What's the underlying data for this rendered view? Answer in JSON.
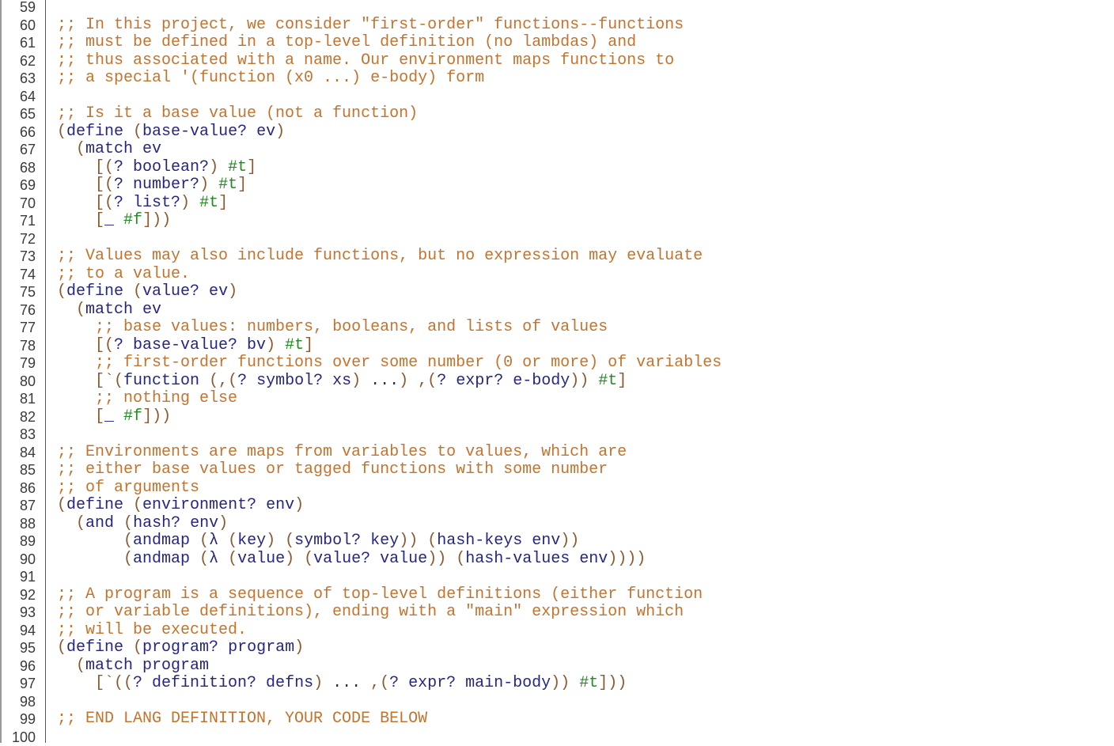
{
  "editor": {
    "colors": {
      "comment": "#c2742f",
      "paren": "#8a5a30",
      "identifier": "#262680",
      "boolean": "#228b22",
      "line_number": "#3a3a3a"
    },
    "lines": [
      {
        "n": "59",
        "tokens": []
      },
      {
        "n": "60",
        "tokens": [
          {
            "t": "c",
            "v": ";; In this project, we consider \"first-order\" functions--functions"
          }
        ]
      },
      {
        "n": "61",
        "tokens": [
          {
            "t": "c",
            "v": ";; must be defined in a top-level definition (no lambdas) and"
          }
        ]
      },
      {
        "n": "62",
        "tokens": [
          {
            "t": "c",
            "v": ";; thus associated with a name. Our environment maps functions to"
          }
        ]
      },
      {
        "n": "63",
        "tokens": [
          {
            "t": "c",
            "v": ";; a special '(function (x0 ...) e-body) form"
          }
        ]
      },
      {
        "n": "64",
        "tokens": []
      },
      {
        "n": "65",
        "tokens": [
          {
            "t": "c",
            "v": ";; Is it a base value (not a function)"
          }
        ]
      },
      {
        "n": "66",
        "tokens": [
          {
            "t": "p",
            "v": "("
          },
          {
            "t": "i",
            "v": "define "
          },
          {
            "t": "p",
            "v": "("
          },
          {
            "t": "i",
            "v": "base-value? ev"
          },
          {
            "t": "p",
            "v": ")"
          }
        ]
      },
      {
        "n": "67",
        "tokens": [
          {
            "t": "i",
            "v": "  "
          },
          {
            "t": "p",
            "v": "("
          },
          {
            "t": "i",
            "v": "match ev"
          }
        ]
      },
      {
        "n": "68",
        "tokens": [
          {
            "t": "i",
            "v": "    "
          },
          {
            "t": "p",
            "v": "[("
          },
          {
            "t": "i",
            "v": "? boolean?"
          },
          {
            "t": "p",
            "v": ")"
          },
          {
            "t": "i",
            "v": " "
          },
          {
            "t": "b",
            "v": "#t"
          },
          {
            "t": "p",
            "v": "]"
          }
        ]
      },
      {
        "n": "69",
        "tokens": [
          {
            "t": "i",
            "v": "    "
          },
          {
            "t": "p",
            "v": "[("
          },
          {
            "t": "i",
            "v": "? number?"
          },
          {
            "t": "p",
            "v": ")"
          },
          {
            "t": "i",
            "v": " "
          },
          {
            "t": "b",
            "v": "#t"
          },
          {
            "t": "p",
            "v": "]"
          }
        ]
      },
      {
        "n": "70",
        "tokens": [
          {
            "t": "i",
            "v": "    "
          },
          {
            "t": "p",
            "v": "[("
          },
          {
            "t": "i",
            "v": "? list?"
          },
          {
            "t": "p",
            "v": ")"
          },
          {
            "t": "i",
            "v": " "
          },
          {
            "t": "b",
            "v": "#t"
          },
          {
            "t": "p",
            "v": "]"
          }
        ]
      },
      {
        "n": "71",
        "tokens": [
          {
            "t": "i",
            "v": "    "
          },
          {
            "t": "p",
            "v": "["
          },
          {
            "t": "i",
            "v": "_ "
          },
          {
            "t": "b",
            "v": "#f"
          },
          {
            "t": "p",
            "v": "]))"
          }
        ]
      },
      {
        "n": "72",
        "tokens": []
      },
      {
        "n": "73",
        "tokens": [
          {
            "t": "c",
            "v": ";; Values may also include functions, but no expression may evaluate"
          }
        ]
      },
      {
        "n": "74",
        "tokens": [
          {
            "t": "c",
            "v": ";; to a value."
          }
        ]
      },
      {
        "n": "75",
        "tokens": [
          {
            "t": "p",
            "v": "("
          },
          {
            "t": "i",
            "v": "define "
          },
          {
            "t": "p",
            "v": "("
          },
          {
            "t": "i",
            "v": "value? ev"
          },
          {
            "t": "p",
            "v": ")"
          }
        ]
      },
      {
        "n": "76",
        "tokens": [
          {
            "t": "i",
            "v": "  "
          },
          {
            "t": "p",
            "v": "("
          },
          {
            "t": "i",
            "v": "match ev"
          }
        ]
      },
      {
        "n": "77",
        "tokens": [
          {
            "t": "i",
            "v": "    "
          },
          {
            "t": "c",
            "v": ";; base values: numbers, booleans, and lists of values"
          }
        ]
      },
      {
        "n": "78",
        "tokens": [
          {
            "t": "i",
            "v": "    "
          },
          {
            "t": "p",
            "v": "[("
          },
          {
            "t": "i",
            "v": "? base-value? bv"
          },
          {
            "t": "p",
            "v": ")"
          },
          {
            "t": "i",
            "v": " "
          },
          {
            "t": "b",
            "v": "#t"
          },
          {
            "t": "p",
            "v": "]"
          }
        ]
      },
      {
        "n": "79",
        "tokens": [
          {
            "t": "i",
            "v": "    "
          },
          {
            "t": "c",
            "v": ";; first-order functions over some number (0 or more) of variables"
          }
        ]
      },
      {
        "n": "80",
        "tokens": [
          {
            "t": "i",
            "v": "    "
          },
          {
            "t": "p",
            "v": "[`("
          },
          {
            "t": "i",
            "v": "function "
          },
          {
            "t": "p",
            "v": "(,("
          },
          {
            "t": "i",
            "v": "? symbol? xs"
          },
          {
            "t": "p",
            "v": ")"
          },
          {
            "t": "i",
            "v": " ..."
          },
          {
            "t": "p",
            "v": ")"
          },
          {
            "t": "i",
            "v": " "
          },
          {
            "t": "p",
            "v": ",("
          },
          {
            "t": "i",
            "v": "? expr? e-body"
          },
          {
            "t": "p",
            "v": "))"
          },
          {
            "t": "i",
            "v": " "
          },
          {
            "t": "b",
            "v": "#t"
          },
          {
            "t": "p",
            "v": "]"
          }
        ]
      },
      {
        "n": "81",
        "tokens": [
          {
            "t": "i",
            "v": "    "
          },
          {
            "t": "c",
            "v": ";; nothing else"
          }
        ]
      },
      {
        "n": "82",
        "tokens": [
          {
            "t": "i",
            "v": "    "
          },
          {
            "t": "p",
            "v": "["
          },
          {
            "t": "i",
            "v": "_ "
          },
          {
            "t": "b",
            "v": "#f"
          },
          {
            "t": "p",
            "v": "]))"
          }
        ]
      },
      {
        "n": "83",
        "tokens": []
      },
      {
        "n": "84",
        "tokens": [
          {
            "t": "c",
            "v": ";; Environments are maps from variables to values, which are"
          }
        ]
      },
      {
        "n": "85",
        "tokens": [
          {
            "t": "c",
            "v": ";; either base values or tagged functions with some number"
          }
        ]
      },
      {
        "n": "86",
        "tokens": [
          {
            "t": "c",
            "v": ";; of arguments"
          }
        ]
      },
      {
        "n": "87",
        "tokens": [
          {
            "t": "p",
            "v": "("
          },
          {
            "t": "i",
            "v": "define "
          },
          {
            "t": "p",
            "v": "("
          },
          {
            "t": "i",
            "v": "environment? env"
          },
          {
            "t": "p",
            "v": ")"
          }
        ]
      },
      {
        "n": "88",
        "tokens": [
          {
            "t": "i",
            "v": "  "
          },
          {
            "t": "p",
            "v": "("
          },
          {
            "t": "i",
            "v": "and "
          },
          {
            "t": "p",
            "v": "("
          },
          {
            "t": "i",
            "v": "hash? env"
          },
          {
            "t": "p",
            "v": ")"
          }
        ]
      },
      {
        "n": "89",
        "tokens": [
          {
            "t": "i",
            "v": "       "
          },
          {
            "t": "p",
            "v": "("
          },
          {
            "t": "i",
            "v": "andmap "
          },
          {
            "t": "p",
            "v": "("
          },
          {
            "t": "i",
            "v": "λ "
          },
          {
            "t": "p",
            "v": "("
          },
          {
            "t": "i",
            "v": "key"
          },
          {
            "t": "p",
            "v": ")"
          },
          {
            "t": "i",
            "v": " "
          },
          {
            "t": "p",
            "v": "("
          },
          {
            "t": "i",
            "v": "symbol? key"
          },
          {
            "t": "p",
            "v": "))"
          },
          {
            "t": "i",
            "v": " "
          },
          {
            "t": "p",
            "v": "("
          },
          {
            "t": "i",
            "v": "hash-keys env"
          },
          {
            "t": "p",
            "v": "))"
          }
        ]
      },
      {
        "n": "90",
        "tokens": [
          {
            "t": "i",
            "v": "       "
          },
          {
            "t": "p",
            "v": "("
          },
          {
            "t": "i",
            "v": "andmap "
          },
          {
            "t": "p",
            "v": "("
          },
          {
            "t": "i",
            "v": "λ "
          },
          {
            "t": "p",
            "v": "("
          },
          {
            "t": "i",
            "v": "value"
          },
          {
            "t": "p",
            "v": ")"
          },
          {
            "t": "i",
            "v": " "
          },
          {
            "t": "p",
            "v": "("
          },
          {
            "t": "i",
            "v": "value? value"
          },
          {
            "t": "p",
            "v": "))"
          },
          {
            "t": "i",
            "v": " "
          },
          {
            "t": "p",
            "v": "("
          },
          {
            "t": "i",
            "v": "hash-values env"
          },
          {
            "t": "p",
            "v": "))))"
          }
        ]
      },
      {
        "n": "91",
        "tokens": []
      },
      {
        "n": "92",
        "tokens": [
          {
            "t": "c",
            "v": ";; A program is a sequence of top-level definitions (either function"
          }
        ]
      },
      {
        "n": "93",
        "tokens": [
          {
            "t": "c",
            "v": ";; or variable definitions), ending with a \"main\" expression which"
          }
        ]
      },
      {
        "n": "94",
        "tokens": [
          {
            "t": "c",
            "v": ";; will be executed."
          }
        ]
      },
      {
        "n": "95",
        "tokens": [
          {
            "t": "p",
            "v": "("
          },
          {
            "t": "i",
            "v": "define "
          },
          {
            "t": "p",
            "v": "("
          },
          {
            "t": "i",
            "v": "program? program"
          },
          {
            "t": "p",
            "v": ")"
          }
        ]
      },
      {
        "n": "96",
        "tokens": [
          {
            "t": "i",
            "v": "  "
          },
          {
            "t": "p",
            "v": "("
          },
          {
            "t": "i",
            "v": "match program"
          }
        ]
      },
      {
        "n": "97",
        "tokens": [
          {
            "t": "i",
            "v": "    "
          },
          {
            "t": "p",
            "v": "[`(("
          },
          {
            "t": "i",
            "v": "? definition? defns"
          },
          {
            "t": "p",
            "v": ")"
          },
          {
            "t": "i",
            "v": " ... "
          },
          {
            "t": "p",
            "v": ",("
          },
          {
            "t": "i",
            "v": "? expr? main-body"
          },
          {
            "t": "p",
            "v": "))"
          },
          {
            "t": "i",
            "v": " "
          },
          {
            "t": "b",
            "v": "#t"
          },
          {
            "t": "p",
            "v": "]))"
          }
        ]
      },
      {
        "n": "98",
        "tokens": []
      },
      {
        "n": "99",
        "tokens": [
          {
            "t": "c",
            "v": ";; END LANG DEFINITION, YOUR CODE BELOW"
          }
        ]
      },
      {
        "n": "100",
        "tokens": []
      }
    ]
  }
}
